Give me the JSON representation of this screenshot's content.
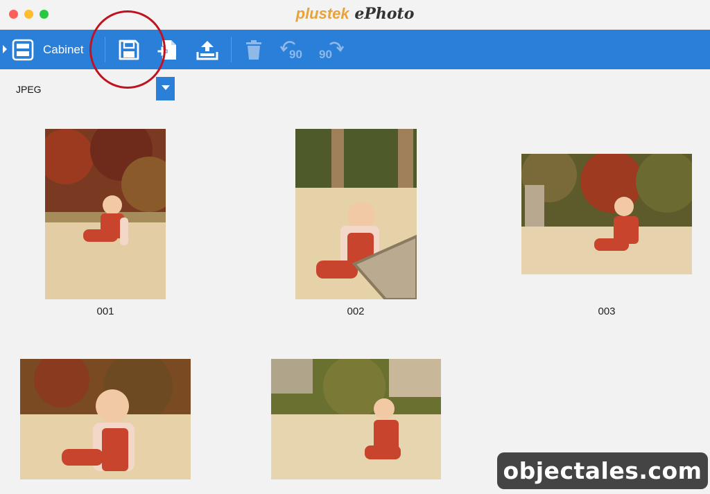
{
  "window": {
    "title_brand": "plustek",
    "title_product": "ePhoto"
  },
  "toolbar": {
    "cabinet_label": "Cabinet",
    "rotate_left_label": "90",
    "rotate_right_label": "90",
    "accent": "#2a7fd8"
  },
  "format": {
    "selected": "JPEG"
  },
  "photos": [
    {
      "caption": "001"
    },
    {
      "caption": "002"
    },
    {
      "caption": "003"
    },
    {
      "caption": ""
    },
    {
      "caption": ""
    }
  ],
  "watermark": {
    "text": "objectales.com"
  },
  "icons": [
    "sidebar-toggle-icon",
    "cabinet-icon",
    "save-icon",
    "new-file-icon",
    "upload-icon",
    "trash-icon",
    "rotate-left-icon",
    "rotate-right-icon",
    "dropdown-arrow-icon"
  ],
  "colors": {
    "annotation_circle": "#c1121f",
    "title_brand": "#e8a33a"
  }
}
